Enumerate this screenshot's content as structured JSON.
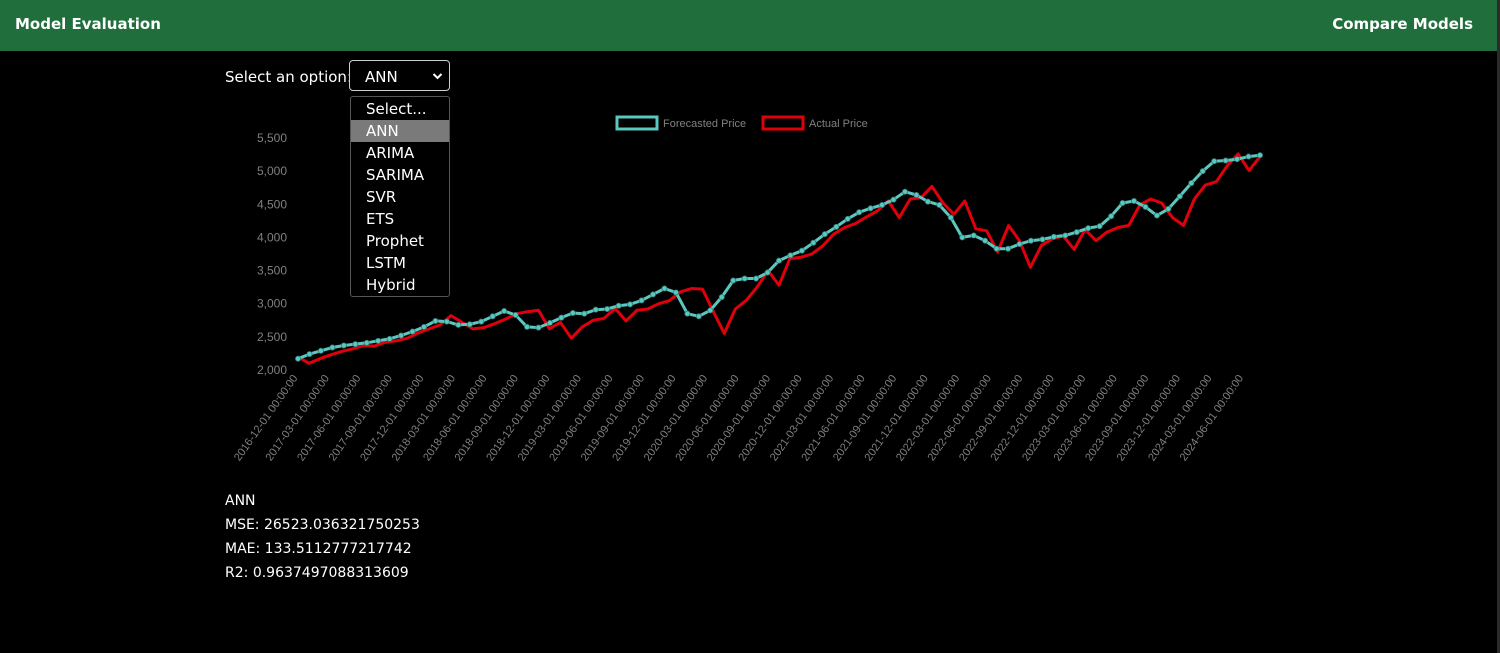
{
  "navbar": {
    "title": "Model Evaluation",
    "compare_label": "Compare Models",
    "color": "#1f6e3b"
  },
  "selector": {
    "label": "Select an option:",
    "selected": "ANN",
    "options": [
      "Select...",
      "ANN",
      "ARIMA",
      "SARIMA",
      "SVR",
      "ETS",
      "Prophet",
      "LSTM",
      "Hybrid"
    ]
  },
  "metrics": {
    "model": "ANN",
    "mse_label": "MSE:",
    "mse": "26523.036321750253",
    "mae_label": "MAE:",
    "mae": "133.5112777217742",
    "r2_label": "R2:",
    "r2": "0.9637497088313609"
  },
  "chart_data": {
    "type": "line",
    "legend_position": "top-center",
    "ylim": [
      2000,
      5500
    ],
    "yticks": [
      "2,000",
      "2,500",
      "3,000",
      "3,500",
      "4,000",
      "4,500",
      "5,000",
      "5,500"
    ],
    "grid": false,
    "x_labels": [
      "2016-12-01 00:00:00",
      "2017-03-01 00:00:00",
      "2017-06-01 00:00:00",
      "2017-09-01 00:00:00",
      "2017-12-01 00:00:00",
      "2018-03-01 00:00:00",
      "2018-06-01 00:00:00",
      "2018-09-01 00:00:00",
      "2018-12-01 00:00:00",
      "2019-03-01 00:00:00",
      "2019-06-01 00:00:00",
      "2019-09-01 00:00:00",
      "2019-12-01 00:00:00",
      "2020-03-01 00:00:00",
      "2020-06-01 00:00:00",
      "2020-09-01 00:00:00",
      "2020-12-01 00:00:00",
      "2021-03-01 00:00:00",
      "2021-06-01 00:00:00",
      "2021-09-01 00:00:00",
      "2021-12-01 00:00:00",
      "2022-03-01 00:00:00",
      "2022-06-01 00:00:00",
      "2022-09-01 00:00:00",
      "2022-12-01 00:00:00",
      "2023-03-01 00:00:00",
      "2023-06-01 00:00:00",
      "2023-09-01 00:00:00",
      "2023-12-01 00:00:00",
      "2024-03-01 00:00:00",
      "2024-06-01 00:00:00"
    ],
    "series": [
      {
        "name": "Forecasted Price",
        "color": "#5bc8c0",
        "markers": true,
        "values": [
          2170,
          2240,
          2290,
          2340,
          2370,
          2390,
          2410,
          2440,
          2470,
          2520,
          2580,
          2650,
          2740,
          2730,
          2680,
          2690,
          2730,
          2810,
          2890,
          2830,
          2650,
          2640,
          2710,
          2790,
          2860,
          2850,
          2910,
          2920,
          2970,
          2990,
          3050,
          3140,
          3230,
          3170,
          2850,
          2810,
          2900,
          3100,
          3350,
          3380,
          3380,
          3470,
          3650,
          3730,
          3800,
          3920,
          4050,
          4160,
          4280,
          4380,
          4440,
          4490,
          4570,
          4690,
          4640,
          4540,
          4490,
          4300,
          4000,
          4030,
          3950,
          3830,
          3830,
          3900,
          3950,
          3970,
          4010,
          4030,
          4080,
          4140,
          4170,
          4320,
          4520,
          4550,
          4460,
          4330,
          4430,
          4620,
          4820,
          5000,
          5150,
          5160,
          5180,
          5220,
          5240
        ]
      },
      {
        "name": "Actual Price",
        "color": "#e0000b",
        "markers": false,
        "values": [
          2200,
          2100,
          2170,
          2230,
          2280,
          2320,
          2370,
          2360,
          2420,
          2440,
          2480,
          2560,
          2620,
          2680,
          2820,
          2720,
          2620,
          2640,
          2700,
          2770,
          2850,
          2880,
          2900,
          2620,
          2720,
          2480,
          2650,
          2750,
          2780,
          2930,
          2740,
          2900,
          2920,
          3000,
          3050,
          3180,
          3230,
          3220,
          2880,
          2550,
          2920,
          3050,
          3250,
          3500,
          3280,
          3680,
          3700,
          3750,
          3870,
          4050,
          4150,
          4210,
          4310,
          4400,
          4550,
          4300,
          4580,
          4600,
          4770,
          4520,
          4350,
          4550,
          4130,
          4100,
          3780,
          4180,
          3950,
          3550,
          3880,
          3980,
          4020,
          3820,
          4120,
          3950,
          4080,
          4150,
          4180,
          4490,
          4580,
          4520,
          4300,
          4180,
          4580,
          4790,
          4840,
          5080,
          5260,
          5010,
          5220
        ]
      }
    ]
  }
}
